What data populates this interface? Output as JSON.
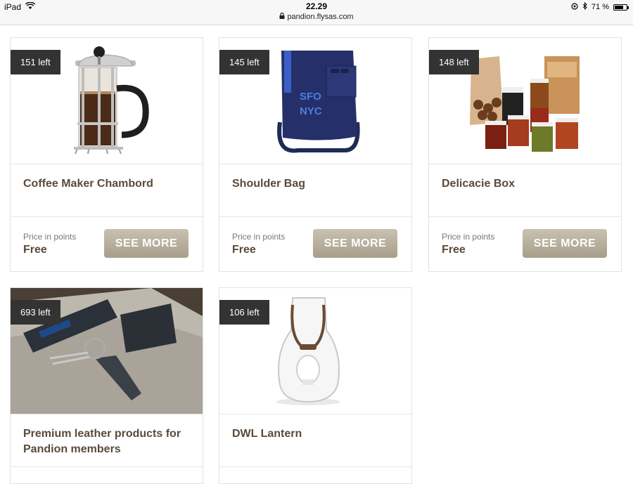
{
  "statusbar": {
    "device": "iPad",
    "time": "22.29",
    "url": "pandion.flysas.com",
    "battery_percent": "71 %"
  },
  "products": [
    {
      "badge": "151 left",
      "title": "Coffee Maker Chambord",
      "price_label": "Price in points",
      "price": "Free",
      "button": "SEE MORE"
    },
    {
      "badge": "145 left",
      "title": "Shoulder Bag",
      "price_label": "Price in points",
      "price": "Free",
      "button": "SEE MORE",
      "bag_print": [
        "SFO",
        "NYC"
      ]
    },
    {
      "badge": "148 left",
      "title": "Delicacie Box",
      "price_label": "Price in points",
      "price": "Free",
      "button": "SEE MORE"
    },
    {
      "badge": "693 left",
      "title": "Premium leather products for Pandion members"
    },
    {
      "badge": "106 left",
      "title": "DWL Lantern"
    }
  ],
  "colors": {
    "badge_bg": "#333333",
    "title_text": "#5a4a3a",
    "button_top": "#c9c1b1",
    "button_bottom": "#a79d8a"
  },
  "icons": [
    "wifi-icon",
    "lock-icon",
    "location-icon",
    "bluetooth-icon",
    "battery-icon"
  ]
}
